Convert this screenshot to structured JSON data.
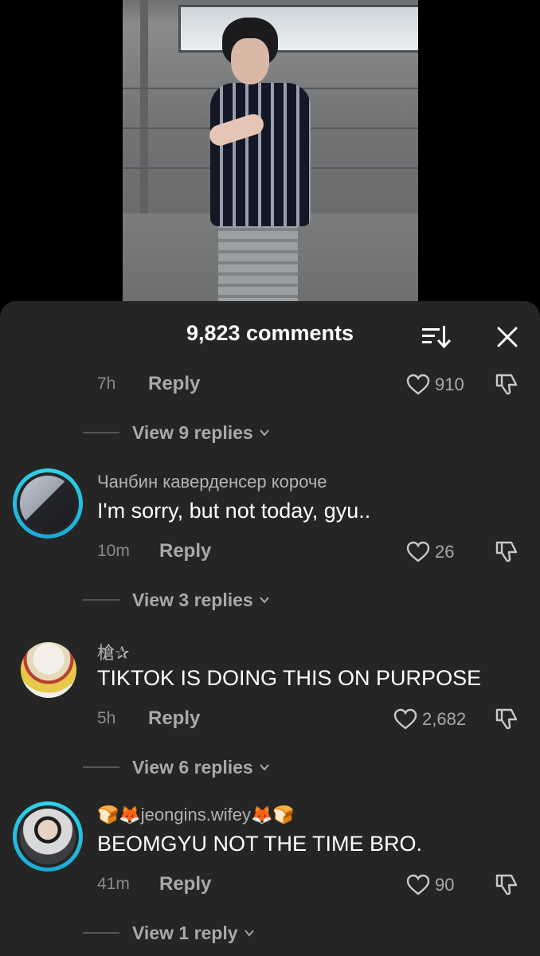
{
  "sheet": {
    "title": "9,823 comments"
  },
  "top_meta": {
    "time": "7h",
    "reply": "Reply",
    "likes": "910"
  },
  "top_view_replies": "View 9 replies",
  "comments": [
    {
      "username": "Чанбин каверденсер короче",
      "text": "I'm sorry, but not today, gyu..",
      "time": "10m",
      "reply": "Reply",
      "likes": "26",
      "view_replies": "View 3 replies",
      "has_story_ring": true
    },
    {
      "username": "槍✰",
      "text": "TIKTOK IS DOING THIS ON PURPOSE",
      "time": "5h",
      "reply": "Reply",
      "likes": "2,682",
      "view_replies": "View 6 replies",
      "has_story_ring": false
    },
    {
      "username": "🍞🦊jeongins.wifey🦊🍞",
      "text": "BEOMGYU NOT THE TIME BRO.",
      "time": "41m",
      "reply": "Reply",
      "likes": "90",
      "view_replies": "View 1 reply",
      "has_story_ring": true
    }
  ],
  "icons": {
    "sort": "sort-icon",
    "close": "close-icon",
    "like": "heart-icon",
    "dislike": "dislike-icon",
    "expand": "chevron-down-icon"
  },
  "colors": {
    "sheet_bg": "#252525",
    "story_ring": "#2fd6ea",
    "secondary_text": "#a9a9a9"
  }
}
